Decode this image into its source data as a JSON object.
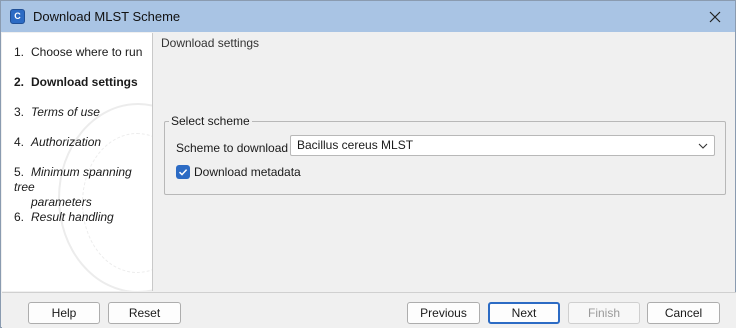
{
  "window": {
    "title": "Download MLST Scheme",
    "app_icon_text": "C",
    "accent_color": "#2c6bc4",
    "titlebar_color": "#a9c4e4"
  },
  "steps": [
    {
      "num": "1.",
      "label": "Choose where to run",
      "style": "normal"
    },
    {
      "num": "2.",
      "label": "Download settings",
      "style": "bold"
    },
    {
      "num": "3.",
      "label": "Terms of use",
      "style": "italic"
    },
    {
      "num": "4.",
      "label": "Authorization",
      "style": "italic"
    },
    {
      "num": "5.",
      "label": "Minimum spanning tree",
      "label2": "parameters",
      "style": "italic"
    },
    {
      "num": "6.",
      "label": "Result handling",
      "style": "italic"
    }
  ],
  "main": {
    "section_title": "Download settings",
    "group": {
      "legend": "Select scheme",
      "scheme_label": "Scheme to download",
      "scheme_value": "Bacillus cereus MLST",
      "metadata_label": "Download metadata",
      "metadata_checked": true
    }
  },
  "footer": {
    "help": "Help",
    "reset": "Reset",
    "previous": "Previous",
    "next": "Next",
    "finish": "Finish",
    "cancel": "Cancel"
  },
  "icons": {
    "close": "close-icon",
    "dropdown": "chevron-down-icon",
    "check": "check-icon"
  }
}
